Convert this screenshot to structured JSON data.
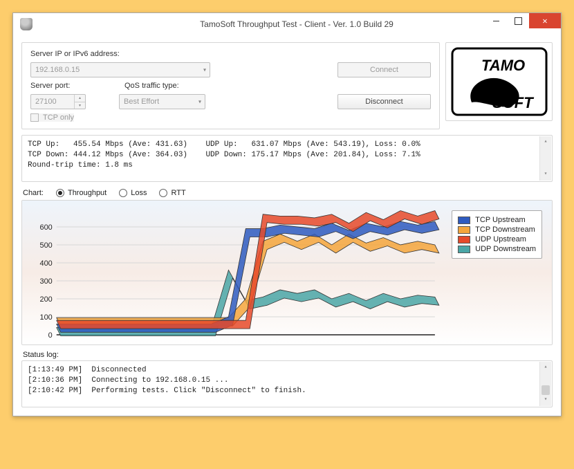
{
  "window": {
    "title": "TamoSoft Throughput Test - Client - Ver. 1.0 Build 29"
  },
  "conn": {
    "server_ip_label": "Server IP or IPv6  address:",
    "server_ip_value": "192.168.0.15",
    "server_port_label": "Server port:",
    "server_port_value": "27100",
    "qos_label": "QoS traffic type:",
    "qos_value": "Best Effort",
    "connect_label": "Connect",
    "disconnect_label": "Disconnect",
    "tcp_only_label": "TCP only"
  },
  "stats_block": "TCP Up:   455.54 Mbps (Ave: 431.63)    UDP Up:   631.07 Mbps (Ave: 543.19), Loss: 0.0%\nTCP Down: 444.12 Mbps (Ave: 364.03)    UDP Down: 175.17 Mbps (Ave: 201.84), Loss: 7.1%\nRound-trip time: 1.8 ms",
  "chart_options": {
    "label": "Chart:",
    "throughput": "Throughput",
    "loss": "Loss",
    "rtt": "RTT",
    "selected": "throughput"
  },
  "legend": {
    "tcp_up": {
      "label": "TCP Upstream",
      "color": "#2e5bc0"
    },
    "tcp_down": {
      "label": "TCP Downstream",
      "color": "#f4a63c"
    },
    "udp_up": {
      "label": "UDP Upstream",
      "color": "#e64a2a"
    },
    "udp_down": {
      "label": "UDP Downstream",
      "color": "#4aa6a6"
    }
  },
  "chart_data": {
    "type": "line",
    "title": "",
    "xlabel": "",
    "ylabel": "",
    "ylim": [
      0,
      700
    ],
    "y_ticks": [
      0,
      100,
      200,
      300,
      400,
      500,
      600
    ],
    "x": [
      0,
      1,
      2,
      3,
      4,
      5,
      6,
      7,
      8,
      9,
      10,
      11,
      12,
      13,
      14,
      15,
      16,
      17,
      18,
      19,
      20,
      21,
      22
    ],
    "series": [
      {
        "name": "TCP Upstream",
        "color": "#2e5bc0",
        "values": [
          60,
          60,
          60,
          60,
          60,
          60,
          60,
          60,
          60,
          60,
          100,
          590,
          590,
          610,
          600,
          590,
          620,
          580,
          620,
          600,
          630,
          610,
          630
        ]
      },
      {
        "name": "TCP Downstream",
        "color": "#f4a63c",
        "values": [
          95,
          95,
          95,
          95,
          95,
          95,
          95,
          95,
          95,
          95,
          95,
          200,
          520,
          560,
          520,
          560,
          500,
          560,
          510,
          540,
          500,
          520,
          500
        ]
      },
      {
        "name": "UDP Upstream",
        "color": "#e64a2a",
        "values": [
          80,
          80,
          80,
          80,
          80,
          80,
          80,
          80,
          80,
          80,
          80,
          80,
          670,
          660,
          660,
          650,
          670,
          620,
          680,
          640,
          690,
          660,
          690
        ]
      },
      {
        "name": "UDP Downstream",
        "color": "#4aa6a6",
        "values": [
          40,
          40,
          40,
          40,
          40,
          40,
          40,
          40,
          40,
          40,
          360,
          190,
          210,
          250,
          230,
          250,
          200,
          230,
          190,
          230,
          200,
          220,
          210
        ]
      }
    ]
  },
  "status": {
    "label": "Status log:",
    "text": "[1:13:49 PM]  Disconnected\n[2:10:36 PM]  Connecting to 192.168.0.15 ...\n[2:10:42 PM]  Performing tests. Click \"Disconnect\" to finish."
  }
}
